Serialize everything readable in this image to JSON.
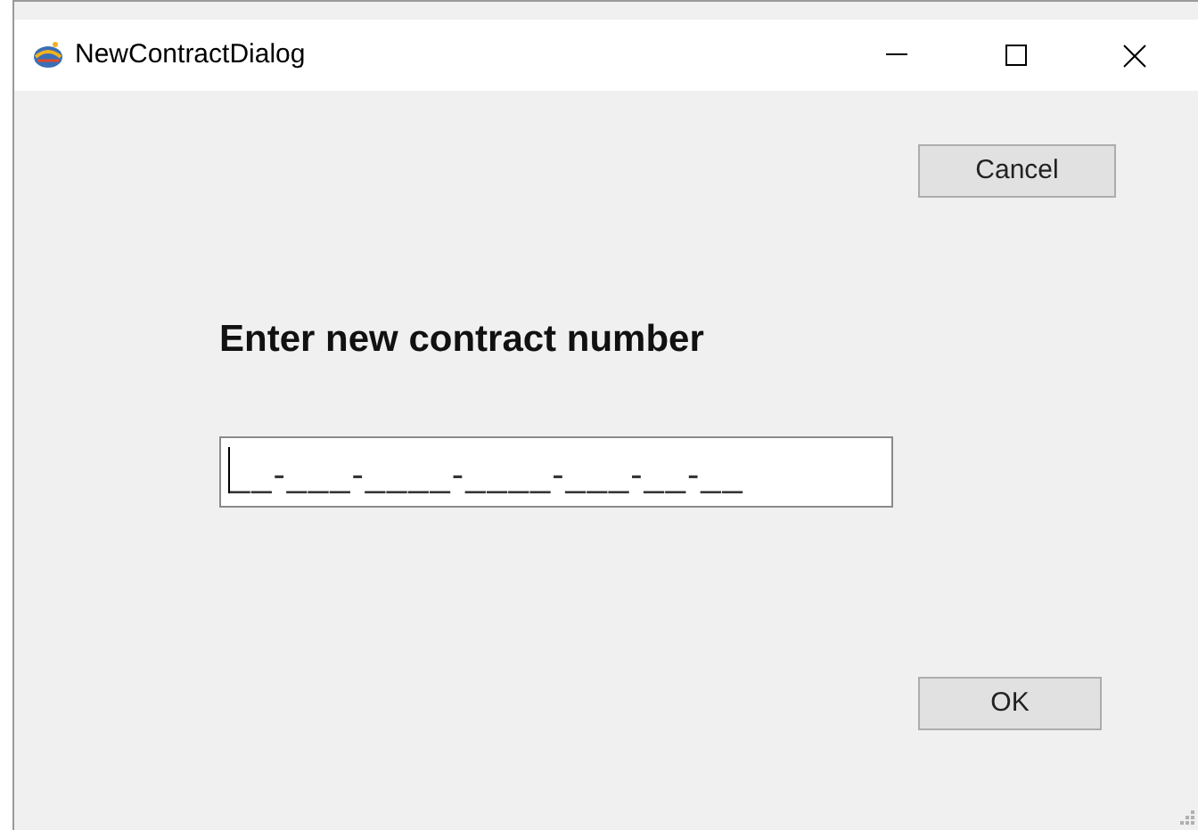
{
  "window": {
    "title": "NewContractDialog"
  },
  "buttons": [
    {
      "kind": "cancel",
      "label": "Cancel"
    },
    {
      "kind": "ok",
      "label": "OK"
    }
  ],
  "prompt": "Enter new contract number",
  "contract_field": {
    "value": "__-___-____-____-___-__-__"
  }
}
